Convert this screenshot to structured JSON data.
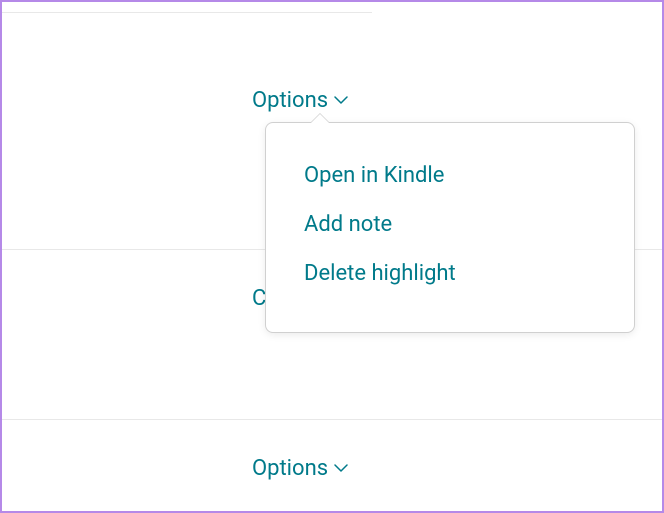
{
  "options": {
    "trigger_label": "Options",
    "menu": {
      "open_in_kindle": "Open in Kindle",
      "add_note": "Add note",
      "delete_highlight": "Delete highlight"
    }
  },
  "colors": {
    "accent": "#007a8a",
    "border": "#b589e8",
    "divider": "#e8e8e8"
  }
}
